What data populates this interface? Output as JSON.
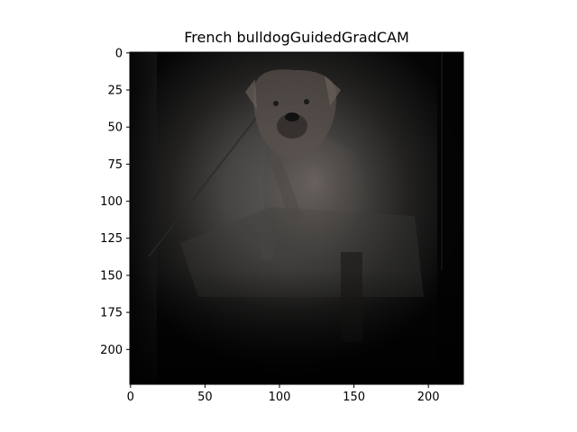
{
  "title": "French bulldogGuidedGradCAM",
  "image": {
    "subject": "dog photo with Guided Grad-CAM heatmap overlay",
    "colors": {
      "background": "#000000",
      "heat_center": "#5a5857",
      "heat_mid": "#2e2d2c",
      "dog_fur": "#6e6460",
      "floor": "#3a3938"
    }
  },
  "axes": {
    "x": {
      "ticks": [
        0,
        50,
        100,
        150,
        200
      ],
      "range": [
        -0.5,
        223.5
      ]
    },
    "y": {
      "ticks": [
        0,
        25,
        50,
        75,
        100,
        125,
        150,
        175,
        200
      ],
      "range": [
        -0.5,
        223.5
      ],
      "inverted": true
    }
  }
}
